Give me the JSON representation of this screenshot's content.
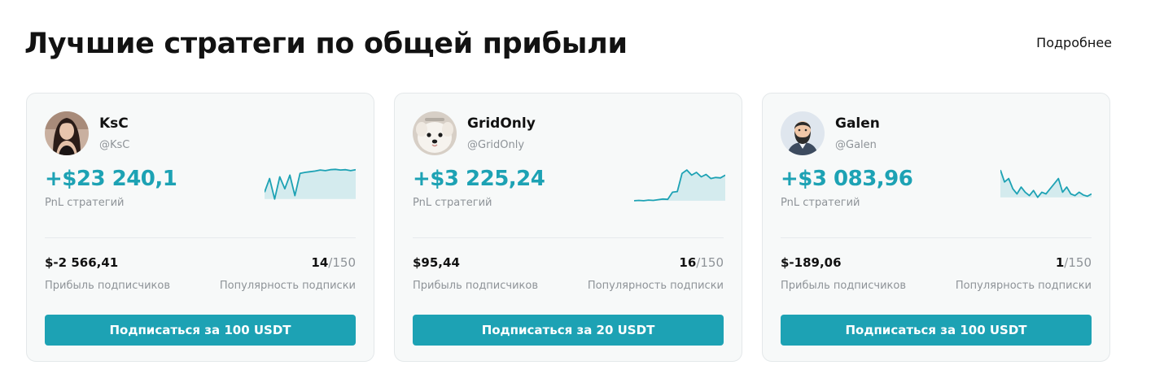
{
  "header": {
    "title": "Лучшие стратеги по общей прибыли",
    "more_link": "Подробнее"
  },
  "colors": {
    "accent": "#1da2b4",
    "card_bg": "#f7f9f9",
    "muted_text": "#8e9398"
  },
  "cards": [
    {
      "name": "KsC",
      "handle": "@KsC",
      "avatar_icon": "user-photo-avatar",
      "pnl": "+$23 240,1",
      "pnl_label": "PnL стратегий",
      "subscriber_profit": "$-2 566,41",
      "subscriber_profit_label": "Прибыль подписчиков",
      "popularity_current": "14",
      "popularity_max": "150",
      "popularity_label": "Популярность подписки",
      "subscribe_label": "Подписаться за 100 USDT",
      "sparkline": [
        0.3,
        0.7,
        0.1,
        0.75,
        0.4,
        0.8,
        0.2,
        0.85,
        0.88,
        0.9,
        0.92,
        0.95,
        0.93,
        0.96,
        0.97,
        0.95,
        0.96,
        0.93,
        0.96
      ]
    },
    {
      "name": "GridOnly",
      "handle": "@GridOnly",
      "avatar_icon": "dog-photo-avatar",
      "pnl": "+$3 225,24",
      "pnl_label": "PnL стратегий",
      "subscriber_profit": "$95,44",
      "subscriber_profit_label": "Прибыль подписчиков",
      "popularity_current": "16",
      "popularity_max": "150",
      "popularity_label": "Популярность подписки",
      "subscribe_label": "Подписаться за 20 USDT",
      "sparkline": [
        0.05,
        0.06,
        0.05,
        0.07,
        0.06,
        0.08,
        0.1,
        0.09,
        0.3,
        0.32,
        0.85,
        0.95,
        0.8,
        0.88,
        0.75,
        0.82,
        0.7,
        0.73,
        0.72,
        0.8
      ]
    },
    {
      "name": "Galen",
      "handle": "@Galen",
      "avatar_icon": "bearded-man-avatar",
      "pnl": "+$3 083,96",
      "pnl_label": "PnL стратегий",
      "subscriber_profit": "$-189,06",
      "subscriber_profit_label": "Прибыль подписчиков",
      "popularity_current": "1",
      "popularity_max": "150",
      "popularity_label": "Популярность подписки",
      "subscribe_label": "Подписаться за 100 USDT",
      "sparkline": [
        0.95,
        0.6,
        0.7,
        0.4,
        0.25,
        0.45,
        0.3,
        0.2,
        0.35,
        0.15,
        0.3,
        0.25,
        0.4,
        0.55,
        0.7,
        0.3,
        0.45,
        0.25,
        0.2,
        0.3,
        0.22,
        0.18,
        0.25
      ]
    }
  ]
}
